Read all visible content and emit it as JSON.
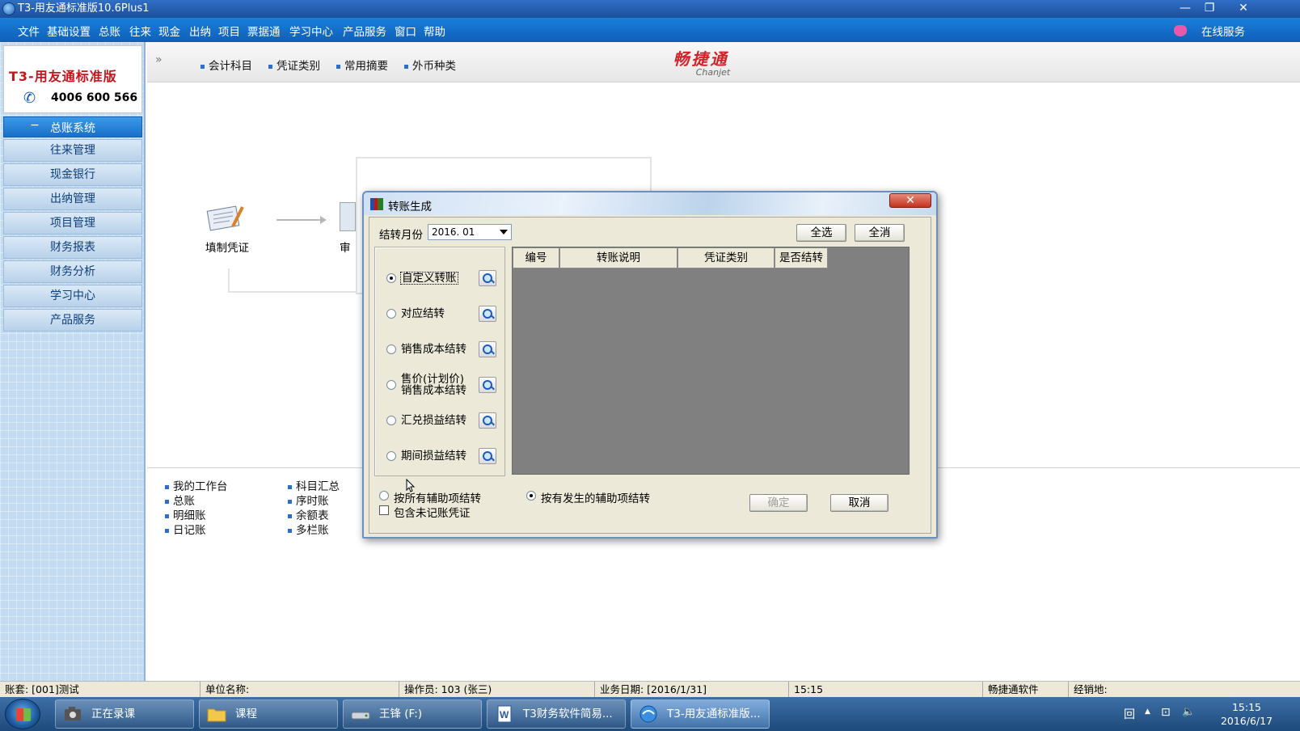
{
  "window": {
    "title": "T3-用友通标准版10.6Plus1",
    "controls": [
      "—",
      "❐",
      "✕"
    ]
  },
  "menu": {
    "items": [
      "文件",
      "基础设置",
      "总账",
      "往来",
      "现金",
      "出纳",
      "项目",
      "票据通",
      "学习中心",
      "产品服务",
      "窗口",
      "帮助"
    ],
    "online_service": "在线服务"
  },
  "sidebar": {
    "logo_title": "T3-用友通标准版",
    "phone": "4006 600 566",
    "system_label": "总账系统",
    "system_toggle": "−",
    "items": [
      {
        "label": "往来管理"
      },
      {
        "label": "现金银行"
      },
      {
        "label": "出纳管理"
      },
      {
        "label": "项目管理"
      },
      {
        "label": "财务报表"
      },
      {
        "label": "财务分析"
      },
      {
        "label": "学习中心"
      },
      {
        "label": "产品服务"
      }
    ]
  },
  "main": {
    "chevron": "»",
    "quick_tabs": [
      "会计科目",
      "凭证类别",
      "常用摘要",
      "外币种类"
    ],
    "brand_cn": "畅捷通",
    "brand_en": "Chanjet",
    "flow": [
      {
        "label": "填制凭证"
      },
      {
        "label": "审"
      }
    ],
    "quick_links_col1": [
      "我的工作台",
      "总账",
      "明细账",
      "日记账"
    ],
    "quick_links_col2": [
      "科目汇总",
      "序时账",
      "余额表",
      "多栏账"
    ]
  },
  "dialog": {
    "title": "转账生成",
    "close": "✕",
    "month_label": "结转月份",
    "month_value": "2016. 01",
    "select_all": "全选",
    "clear_all": "全消",
    "options": [
      {
        "label": "自定义转账",
        "selected": true
      },
      {
        "label": "对应结转",
        "selected": false
      },
      {
        "label": "销售成本结转",
        "selected": false
      },
      {
        "label": "售价(计划价)销售成本结转",
        "label_line1": "售价(计划价)",
        "label_line2": "销售成本结转",
        "selected": false
      },
      {
        "label": "汇兑损益结转",
        "selected": false
      },
      {
        "label": "期间损益结转",
        "selected": false
      }
    ],
    "table_headers": [
      "编号",
      "转账说明",
      "凭证类别",
      "是否结转"
    ],
    "aux_option_all": "按所有辅助项结转",
    "aux_option_occurred": "按有发生的辅助项结转",
    "include_unposted": "包含未记账凭证",
    "ok": "确定",
    "cancel": "取消"
  },
  "statusbar": {
    "account_set": "账套: [001]测试",
    "unit_name": "单位名称:",
    "operator": "操作员: 103 (张三)",
    "business_date": "业务日期: [2016/1/31]",
    "time": "15:15",
    "vendor": "畅捷通软件",
    "manager": "经销地:"
  },
  "taskbar": {
    "buttons": [
      {
        "label": "正在录课",
        "icon": "camera-icon"
      },
      {
        "label": "课程",
        "icon": "folder-icon"
      },
      {
        "label": "王锋 (F:)",
        "icon": "drive-icon"
      },
      {
        "label": "T3财务软件简易...",
        "icon": "word-icon"
      },
      {
        "label": "T3-用友通标准版...",
        "icon": "t3-app-icon",
        "active": true
      }
    ],
    "time": "15:15",
    "date": "2016/6/17",
    "tray_glyphs": [
      "回",
      "▲",
      "⊡",
      "🔈"
    ]
  },
  "colors": {
    "menubar": "#1a7fda",
    "brand_red": "#d1222a",
    "dialog_bg": "#ece9d8",
    "grid_bg": "#808080"
  }
}
